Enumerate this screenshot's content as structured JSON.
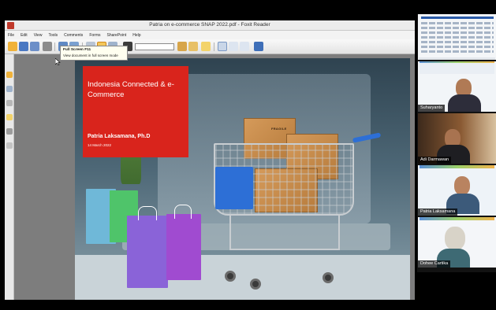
{
  "window": {
    "title": "Patria on e-commerce SNAP 2022.pdf - Foxit Reader"
  },
  "menu": {
    "items": [
      "File",
      "Edit",
      "View",
      "Tools",
      "Comments",
      "Forms",
      "SharePoint",
      "Help"
    ]
  },
  "tooltip": {
    "title": "Full Screen  F11",
    "description": "View document in full screen mode"
  },
  "slide": {
    "title": "Indonesia Connected & e-Commerce",
    "author": "Patria Laksamana, Ph.D",
    "date": "14 March 2022",
    "box_label": "FRAGILE"
  },
  "video_panel": {
    "participants": [
      {
        "name": "Suharyanto"
      },
      {
        "name": "Adi Darmawan"
      },
      {
        "name": "Patria Laksamana"
      },
      {
        "name": "Dohee Cartika"
      }
    ]
  },
  "colors": {
    "slide_red": "#d9241c",
    "cart_blue": "#2d6fd6",
    "canvas_gray": "#7d7d7d"
  },
  "icons": [
    "open-icon",
    "save-icon",
    "print-icon",
    "email-icon",
    "full-screen-icon",
    "zoom-icon",
    "hand-icon",
    "select-icon",
    "bookmark-icon",
    "comment-icon"
  ]
}
